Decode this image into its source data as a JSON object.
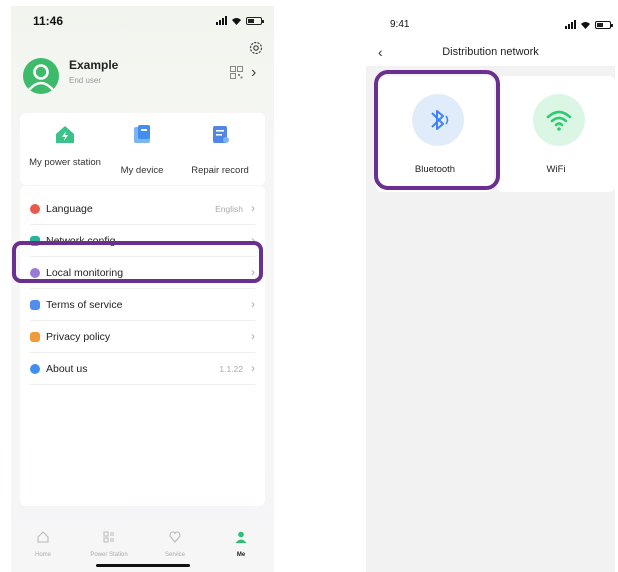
{
  "left": {
    "status": {
      "time": "11:46"
    },
    "profile": {
      "name": "Example",
      "role": "End user"
    },
    "quick_actions": [
      {
        "label": "My power station",
        "icon": "power-station-icon"
      },
      {
        "label": "My device",
        "icon": "device-icon"
      },
      {
        "label": "Repair record",
        "icon": "repair-record-icon"
      }
    ],
    "menu": [
      {
        "label": "Language",
        "value": "English",
        "icon": "language-icon",
        "color": "#e85a4a"
      },
      {
        "label": "Network config",
        "value": "",
        "icon": "network-config-icon",
        "color": "#26b59a"
      },
      {
        "label": "Local monitoring",
        "value": "",
        "icon": "local-monitoring-icon",
        "color": "#9a7ad6"
      },
      {
        "label": "Terms of service",
        "value": "",
        "icon": "terms-icon",
        "color": "#4f8ef0"
      },
      {
        "label": "Privacy policy",
        "value": "",
        "icon": "privacy-icon",
        "color": "#f29a3b"
      },
      {
        "label": "About us",
        "value": "1.1.22",
        "icon": "about-icon",
        "color": "#3d8ff5"
      }
    ],
    "tabs": [
      {
        "label": "Home",
        "icon": "home-icon"
      },
      {
        "label": "Power Station",
        "icon": "power-station-tab-icon"
      },
      {
        "label": "Service",
        "icon": "service-icon"
      },
      {
        "label": "Me",
        "icon": "me-icon"
      }
    ],
    "highlight_color": "#6b2f8f"
  },
  "right": {
    "status": {
      "time": "9:41"
    },
    "title": "Distribution network",
    "options": [
      {
        "label": "Bluetooth",
        "icon": "bluetooth-icon",
        "color": "#3f83f8"
      },
      {
        "label": "WiFi",
        "icon": "wifi-icon",
        "color": "#2ecc71"
      }
    ]
  }
}
